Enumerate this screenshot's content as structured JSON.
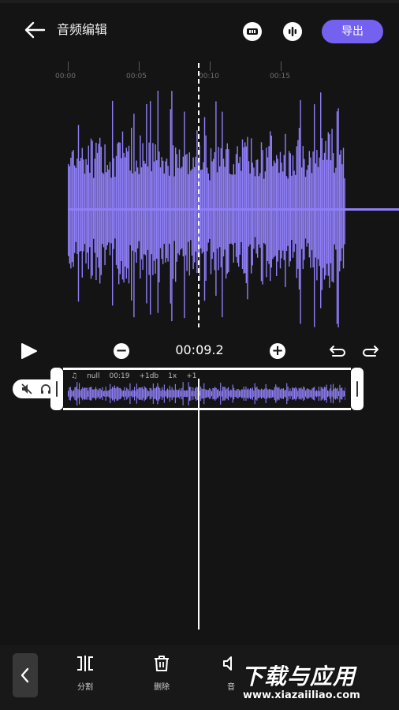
{
  "header": {
    "title": "音频编辑",
    "export_label": "导出"
  },
  "ruler": {
    "labels": [
      "00:00",
      "00:05",
      "00:10",
      "00:15"
    ]
  },
  "controls": {
    "current_time": "00:09.2"
  },
  "track": {
    "info": [
      "null",
      "00:19",
      "+1db",
      "1x",
      "+1"
    ]
  },
  "toolbar": {
    "items": [
      {
        "label": "分割",
        "icon": "split-icon"
      },
      {
        "label": "删除",
        "icon": "trash-icon"
      },
      {
        "label": "音",
        "icon": "volume-icon"
      }
    ]
  },
  "watermark": {
    "main": "下载与应用",
    "sub": "www.xiazaiiliao.com"
  },
  "colors": {
    "accent": "#7461f0",
    "waveform": "#8f7ff7",
    "background": "#141414"
  }
}
